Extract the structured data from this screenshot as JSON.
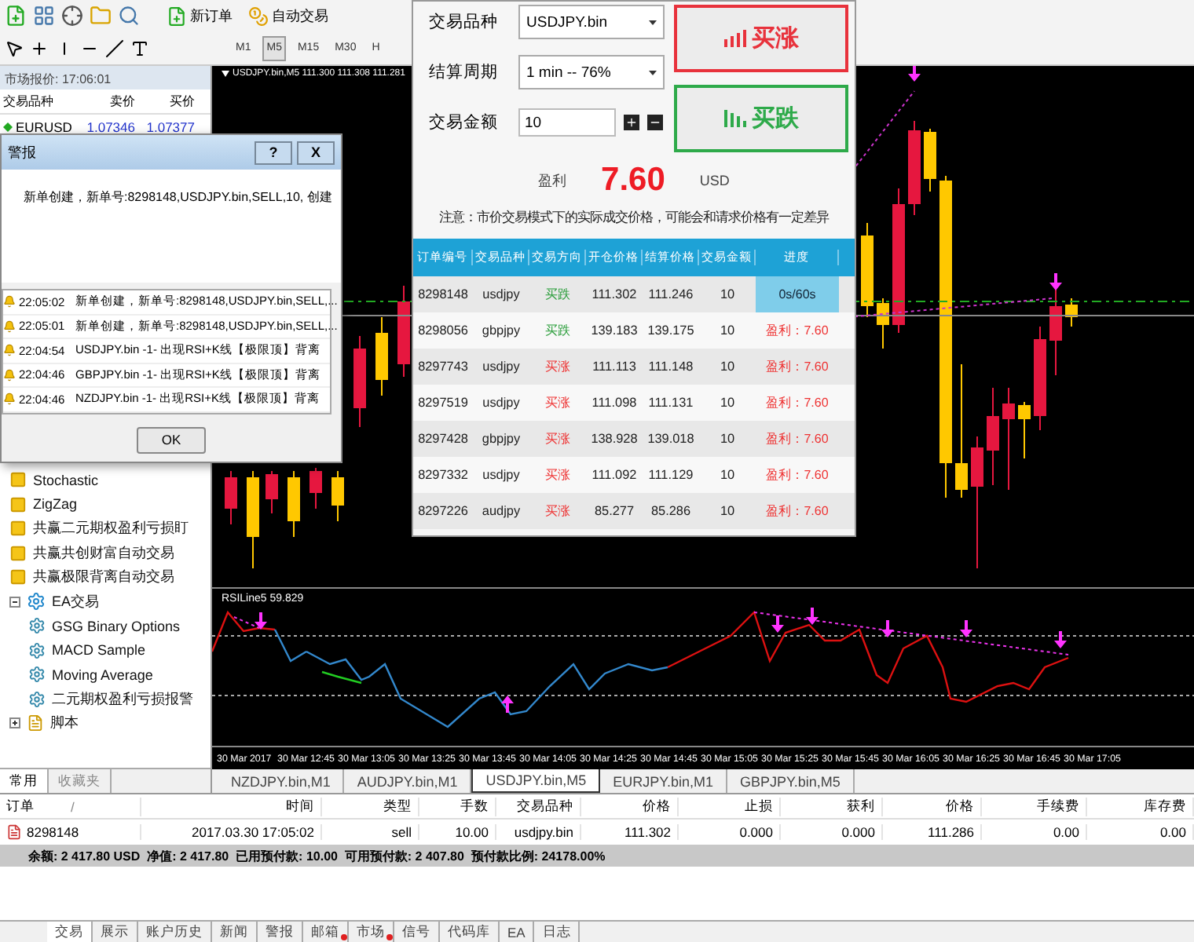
{
  "toolbar": {
    "buttons": [
      {
        "label": "新订单"
      },
      {
        "label": "自动交易"
      }
    ],
    "timeframes": [
      {
        "label": "M1",
        "selected": false
      },
      {
        "label": "M5",
        "selected": true
      },
      {
        "label": "M15",
        "selected": false
      },
      {
        "label": "M30",
        "selected": false
      },
      {
        "label": "H",
        "selected": false
      }
    ]
  },
  "market_watch": {
    "title": "市场报价: 17:06:01",
    "columns": [
      "交易品种",
      "卖价",
      "买价"
    ],
    "rows": [
      {
        "symbol": "EURUSD",
        "bid": "1.07346",
        "ask": "1.07377"
      }
    ]
  },
  "navigator": {
    "items": [
      {
        "label": "Stochastic",
        "kind": "indicator"
      },
      {
        "label": "ZigZag",
        "kind": "indicator"
      },
      {
        "label": "共赢二元期权盈利亏损盯",
        "kind": "indicator"
      },
      {
        "label": "共赢共创财富自动交易",
        "kind": "indicator"
      },
      {
        "label": "共赢极限背离自动交易",
        "kind": "indicator"
      },
      {
        "label": "EA交易",
        "kind": "folder",
        "expanded": true,
        "children": [
          {
            "label": "GSG Binary Options",
            "kind": "expert"
          },
          {
            "label": "MACD Sample",
            "kind": "expert"
          },
          {
            "label": "Moving Average",
            "kind": "expert"
          },
          {
            "label": "二元期权盈利亏损报警",
            "kind": "expert"
          }
        ]
      },
      {
        "label": "脚本",
        "kind": "scripts",
        "expanded": false
      }
    ],
    "tabs": [
      {
        "label": "常用",
        "selected": true
      },
      {
        "label": "收藏夹",
        "selected": false
      }
    ]
  },
  "chart": {
    "title": "USDJPY.bin,M5  111.300 111.308 111.281",
    "indicator_label": "RSILine5 59.829",
    "time_labels": [
      "30 Mar 2017",
      "30 Mar 12:45",
      "30 Mar 13:05",
      "30 Mar 13:25",
      "30 Mar 13:45",
      "30 Mar 14:05",
      "30 Mar 14:25",
      "30 Mar 14:45",
      "30 Mar 15:05",
      "30 Mar 15:25",
      "30 Mar 15:45",
      "30 Mar 16:05",
      "30 Mar 16:25",
      "30 Mar 16:45",
      "30 Mar 17:05"
    ],
    "tabs": [
      {
        "label": "NZDJPY.bin,M1",
        "selected": false
      },
      {
        "label": "AUDJPY.bin,M1",
        "selected": false
      },
      {
        "label": "USDJPY.bin,M5",
        "selected": true
      },
      {
        "label": "EURJPY.bin,M1",
        "selected": false
      },
      {
        "label": "GBPJPY.bin,M5",
        "selected": false
      }
    ]
  },
  "terminal": {
    "columns": [
      "订单",
      "时间",
      "类型",
      "手数",
      "交易品种",
      "价格",
      "止损",
      "获利",
      "价格",
      "手续费",
      "库存费"
    ],
    "sort_mark": "/",
    "rows": [
      {
        "cells": [
          "8298148",
          "2017.03.30 17:05:02",
          "sell",
          "10.00",
          "usdjpy.bin",
          "111.302",
          "0.000",
          "0.000",
          "111.286",
          "0.00",
          "0.00"
        ]
      }
    ],
    "summary": "余额: 2 417.80 USD  净值: 2 417.80  已用预付款: 10.00  可用预付款: 2 407.80  预付款比例: 24178.00%",
    "tabs": [
      {
        "label": "交易",
        "selected": true,
        "notify": false
      },
      {
        "label": "展示",
        "selected": false,
        "notify": false
      },
      {
        "label": "账户历史",
        "selected": false,
        "notify": false
      },
      {
        "label": "新闻",
        "selected": false,
        "notify": false
      },
      {
        "label": "警报",
        "selected": false,
        "notify": false
      },
      {
        "label": "邮箱",
        "selected": false,
        "notify": true
      },
      {
        "label": "市场",
        "selected": false,
        "notify": true
      },
      {
        "label": "信号",
        "selected": false,
        "notify": false
      },
      {
        "label": "代码库",
        "selected": false,
        "notify": false
      },
      {
        "label": "EA",
        "selected": false,
        "notify": false
      },
      {
        "label": "日志",
        "selected": false,
        "notify": false
      }
    ]
  },
  "alert_dialog": {
    "title": "警报",
    "help": "?",
    "close": "X",
    "message": "新单创建，新单号:8298148,USDJPY.bin,SELL,10, 创建",
    "entries": [
      {
        "time": "22:05:02",
        "text": "新单创建，新单号:8298148,USDJPY.bin,SELL,..."
      },
      {
        "time": "22:05:01",
        "text": "新单创建，新单号:8298148,USDJPY.bin,SELL,..."
      },
      {
        "time": "22:04:54",
        "text": "USDJPY.bin -1- 出现RSI+K线【极限顶】背离"
      },
      {
        "time": "22:04:46",
        "text": "GBPJPY.bin -1- 出现RSI+K线【极限顶】背离"
      },
      {
        "time": "22:04:46",
        "text": "NZDJPY.bin -1- 出现RSI+K线【极限顶】背离"
      }
    ],
    "ok": "OK"
  },
  "trade_panel": {
    "symbol_label": "交易品种",
    "symbol": "USDJPY.bin",
    "period_label": "结算周期",
    "period": "1 min -- 76%",
    "amount_label": "交易金额",
    "amount": "10",
    "buy_up": "买涨",
    "buy_down": "买跌",
    "profit_label": "盈利",
    "profit": "7.60",
    "currency": "USD",
    "notice": "注意：市价交易模式下的实际成交价格，可能会和请求价格有一定差异",
    "columns": [
      "订单编号",
      "交易品种",
      "交易方向",
      "开仓价格",
      "结算价格",
      "交易金额",
      "进度"
    ],
    "rows": [
      {
        "id": "8298148",
        "symbol": "usdjpy",
        "direction": "买跌",
        "color": "#2a9d3a",
        "open": "111.302",
        "close": "111.246",
        "amount": "10",
        "status": "0s/60s",
        "kind": "running"
      },
      {
        "id": "8298056",
        "symbol": "gbpjpy",
        "direction": "买跌",
        "color": "#2a9d3a",
        "open": "139.183",
        "close": "139.175",
        "amount": "10",
        "status": "盈利：7.60",
        "kind": "profit"
      },
      {
        "id": "8297743",
        "symbol": "usdjpy",
        "direction": "买涨",
        "color": "#ee3333",
        "open": "111.113",
        "close": "111.148",
        "amount": "10",
        "status": "盈利：7.60",
        "kind": "profit"
      },
      {
        "id": "8297519",
        "symbol": "usdjpy",
        "direction": "买涨",
        "color": "#ee3333",
        "open": "111.098",
        "close": "111.131",
        "amount": "10",
        "status": "盈利：7.60",
        "kind": "profit"
      },
      {
        "id": "8297428",
        "symbol": "gbpjpy",
        "direction": "买涨",
        "color": "#ee3333",
        "open": "138.928",
        "close": "139.018",
        "amount": "10",
        "status": "盈利：7.60",
        "kind": "profit"
      },
      {
        "id": "8297332",
        "symbol": "usdjpy",
        "direction": "买涨",
        "color": "#ee3333",
        "open": "111.092",
        "close": "111.129",
        "amount": "10",
        "status": "盈利：7.60",
        "kind": "profit"
      },
      {
        "id": "8297226",
        "symbol": "audjpy",
        "direction": "买涨",
        "color": "#ee3333",
        "open": "85.277",
        "close": "85.286",
        "amount": "10",
        "status": "盈利：7.60",
        "kind": "profit"
      }
    ]
  }
}
